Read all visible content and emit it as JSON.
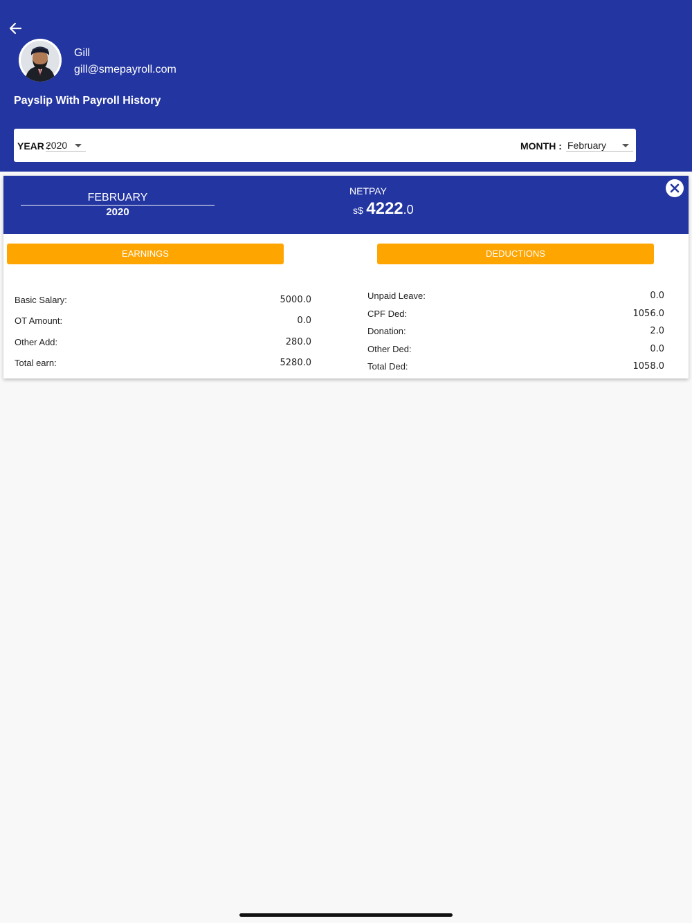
{
  "header": {
    "back_icon": "arrow-left-icon",
    "user_name": "Gill",
    "user_email": "gill@smepayroll.com",
    "page_title": "Payslip With Payroll History",
    "bg_color": "#2335a0"
  },
  "filters": {
    "year_label": "YEAR :",
    "year_value": "2020",
    "month_label": "MONTH :",
    "month_value": "February"
  },
  "payslip": {
    "period_month": "FEBRUARY",
    "period_year": "2020",
    "netpay_label": "NETPAY",
    "netpay_currency": "s$",
    "netpay_int": "4222",
    "netpay_dec": ".0",
    "close_icon": "close-circle-icon",
    "accent_color": "#ffa500",
    "tabs": {
      "earnings": "EARNINGS",
      "deductions": "DEDUCTIONS"
    },
    "earnings": [
      {
        "label": "Basic Salary:",
        "value": "5000.0"
      },
      {
        "label": "OT Amount:",
        "value": "0.0"
      },
      {
        "label": "Other Add:",
        "value": "280.0"
      },
      {
        "label": "Total earn:",
        "value": "5280.0"
      }
    ],
    "deductions": [
      {
        "label": "Unpaid Leave:",
        "value": "0.0"
      },
      {
        "label": "CPF Ded:",
        "value": "1056.0"
      },
      {
        "label": "Donation:",
        "value": "2.0"
      },
      {
        "label": "Other Ded:",
        "value": "0.0"
      },
      {
        "label": "Total Ded:",
        "value": "1058.0"
      }
    ]
  }
}
